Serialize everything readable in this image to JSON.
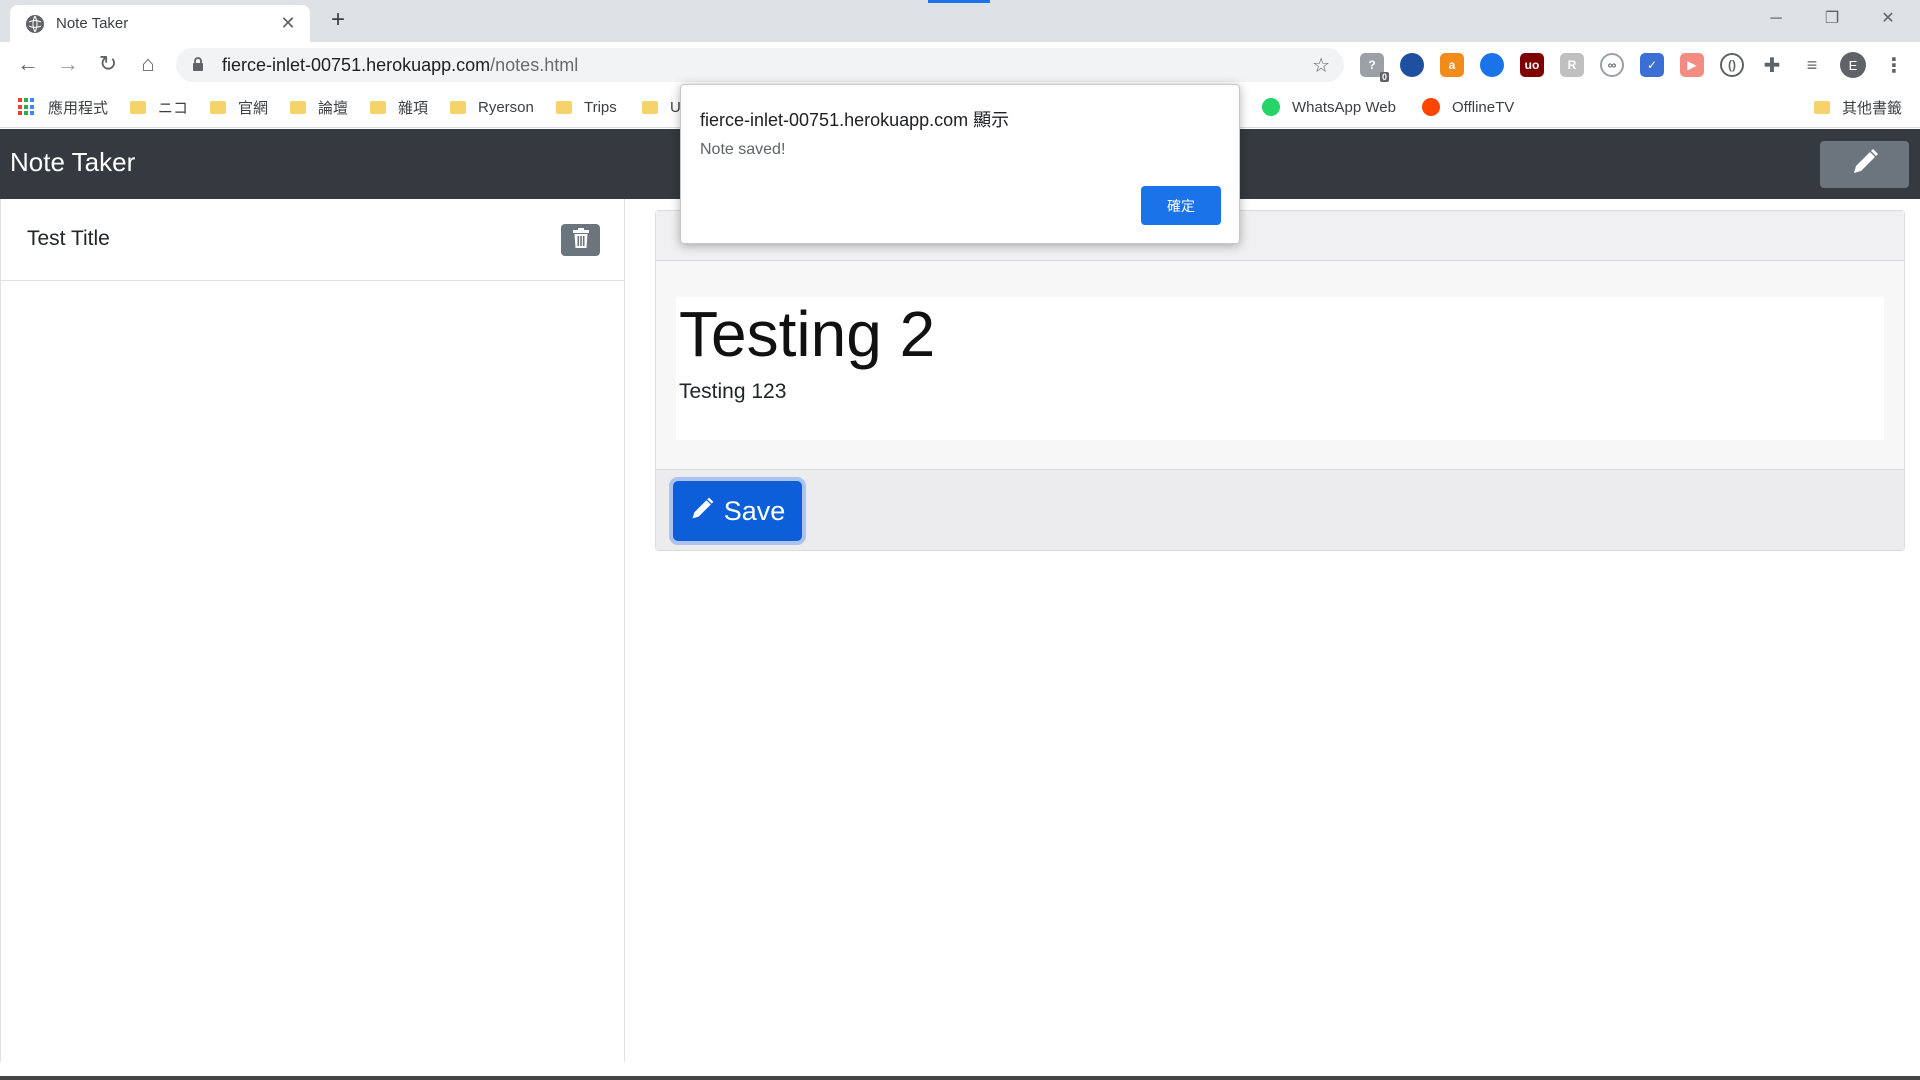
{
  "browser": {
    "tab_title": "Note Taker",
    "tab_close": "✕",
    "new_tab": "+",
    "url_host": "fierce-inlet-00751.herokuapp.com",
    "url_path": "/notes.html",
    "profile_initial": "E",
    "ext_badge": "0",
    "window": {
      "minimize": "─",
      "restore": "❐",
      "close": "✕"
    },
    "nav": {
      "back": "←",
      "forward": "→",
      "reload": "↻",
      "home": "⌂"
    },
    "bookmarks": [
      {
        "label": "應用程式",
        "type": "apps"
      },
      {
        "label": "ニコ",
        "type": "folder"
      },
      {
        "label": "官網",
        "type": "folder"
      },
      {
        "label": "論壇",
        "type": "folder"
      },
      {
        "label": "雜項",
        "type": "folder"
      },
      {
        "label": "Ryerson",
        "type": "folder"
      },
      {
        "label": "Trips",
        "type": "folder"
      },
      {
        "label": "U",
        "type": "folder"
      },
      {
        "label": "WhatsApp Web",
        "type": "whatsapp"
      },
      {
        "label": "OfflineTV",
        "type": "reddit"
      },
      {
        "label": "其他書籤",
        "type": "folder"
      }
    ]
  },
  "app": {
    "brand": "Note Taker",
    "notes_list": [
      {
        "title": "Test Title"
      }
    ],
    "editor": {
      "header": "",
      "note_title": "Testing 2",
      "note_text": "Testing 123",
      "save_label": "Save"
    }
  },
  "dialog": {
    "title": "fierce-inlet-00751.herokuapp.com 顯示",
    "message": "Note saved!",
    "ok_label": "確定"
  },
  "colors": {
    "navbar": "#343a40",
    "accent": "#0d5fd9",
    "dialog_button": "#1a73e8",
    "secondary_button": "#6c757d"
  }
}
